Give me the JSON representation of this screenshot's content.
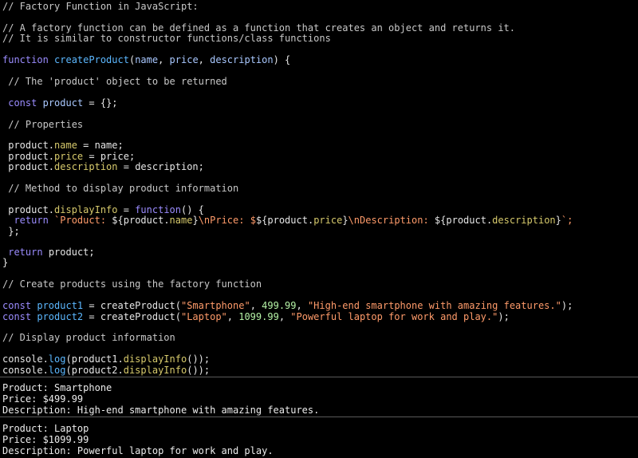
{
  "editor": {
    "header_comment": "// Factory Function in JavaScript:",
    "desc_comment_1": "// A factory function can be defined as a function that creates an object and returns it.",
    "desc_comment_2": "// It is similar to constructor functions/class functions",
    "fn_keyword": "function",
    "fn_name": "createProduct",
    "fn_open_paren": "(",
    "param_name": "name",
    "param_sep1": ", ",
    "param_price": "price",
    "param_sep2": ", ",
    "param_desc": "description",
    "fn_close": ") {",
    "comment_product_obj": "// The 'product' object to be returned",
    "const_kw": "const",
    "product_var": "product",
    "product_init": " = {};",
    "comment_properties": "// Properties",
    "assign_name_obj": "product.",
    "assign_name_prop": "name",
    "assign_name_rest": " = name;",
    "assign_price_obj": "product.",
    "assign_price_prop": "price",
    "assign_price_rest": " = price;",
    "assign_desc_obj": "product.",
    "assign_desc_prop": "description",
    "assign_desc_rest": " = description;",
    "comment_method": "// Method to display product information",
    "method_obj": "product.",
    "method_prop": "displayInfo",
    "method_eq": " = ",
    "method_fn_kw": "function",
    "method_open": "() {",
    "return_kw": "return",
    "tpl_1": " `Product: ",
    "tpl_2": "${product.",
    "tpl_3": "name",
    "tpl_4": "}",
    "tpl_5": "\\nPrice: $",
    "tpl_6": "${product.",
    "tpl_7": "price",
    "tpl_8": "}",
    "tpl_9": "\\nDescription: ",
    "tpl_10": "${product.",
    "tpl_11": "description",
    "tpl_12": "}",
    "tpl_13": "`;",
    "method_close": "};",
    "return2_kw": "return",
    "return2_rest": " product;",
    "fn_end": "}",
    "comment_create": "// Create products using the factory function",
    "p1_const": "const",
    "p1_var": "product1",
    "p1_call": " = createProduct(",
    "p1_str1": "\"Smartphone\"",
    "p1_sep1": ", ",
    "p1_num": "499.99",
    "p1_sep2": ", ",
    "p1_str2": "\"High-end smartphone with amazing features.\"",
    "p1_end": ");",
    "p2_const": "const",
    "p2_var": "product2",
    "p2_call": " = createProduct(",
    "p2_str1": "\"Laptop\"",
    "p2_sep1": ", ",
    "p2_num": "1099.99",
    "p2_sep2": ", ",
    "p2_str2": "\"Powerful laptop for work and play.\"",
    "p2_end": ");",
    "comment_display": "// Display product information",
    "log1_console": "console.",
    "log1_log": "log",
    "log1_mid": "(product1.",
    "log1_fn": "displayInfo",
    "log1_end": "());",
    "log2_console": "console.",
    "log2_log": "log",
    "log2_mid": "(product2.",
    "log2_fn": "displayInfo",
    "log2_end": "());"
  },
  "console": {
    "output1": [
      "Product: Smartphone",
      "Price: $499.99",
      "Description: High-end smartphone with amazing features."
    ],
    "output2": [
      "Product: Laptop",
      "Price: $1099.99",
      "Description: Powerful laptop for work and play."
    ]
  },
  "colors": {
    "background": "#000000",
    "comment": "#c8c8c8",
    "keyword": "#9b8cff",
    "function_name": "#5cb8ff",
    "property": "#d7ca6c",
    "string": "#ff9b6a",
    "number": "#b5f2a6",
    "divider": "#5a5a5a"
  }
}
